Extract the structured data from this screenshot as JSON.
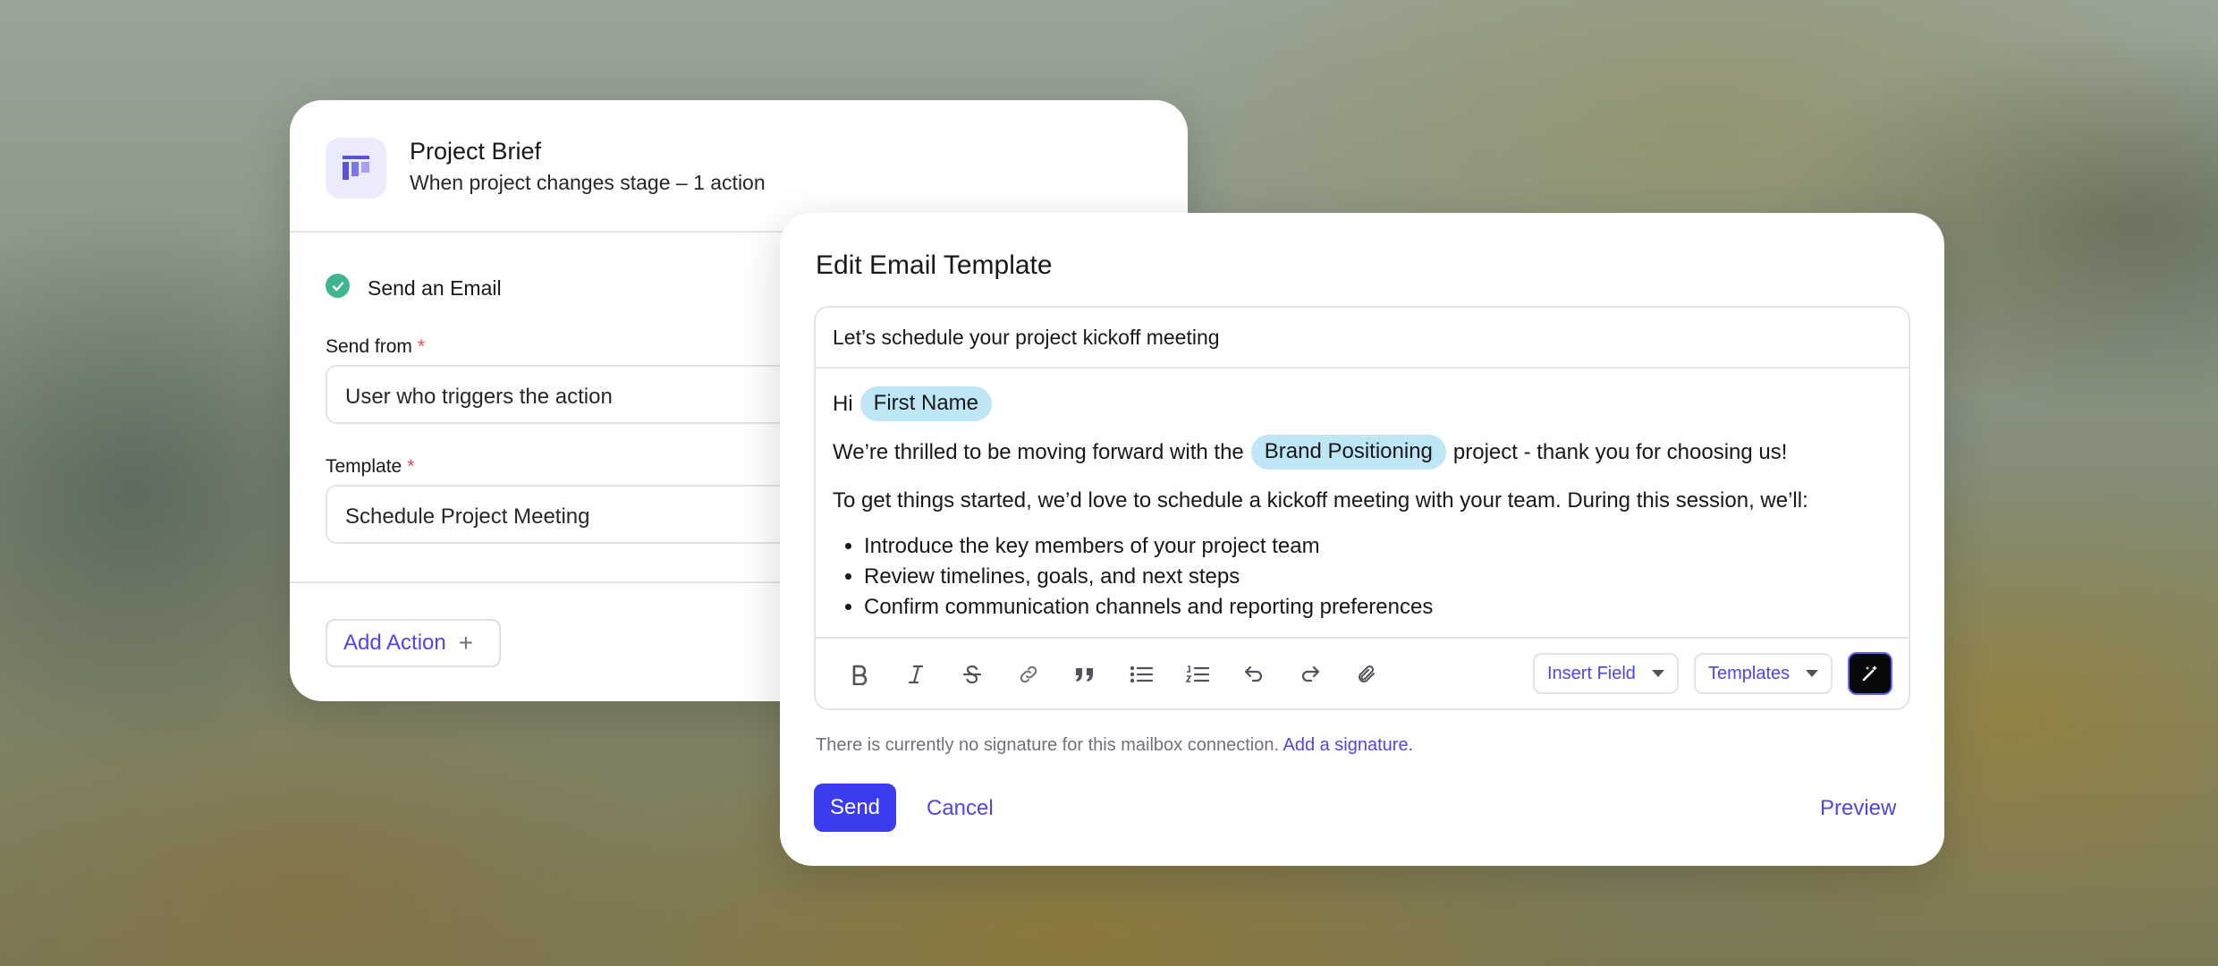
{
  "brief": {
    "title": "Project Brief",
    "subtitle": "When project changes stage – 1 action",
    "logo_icon": "board-columns-icon",
    "action_label": "Send an Email",
    "send_from_label": "Send from",
    "send_from_value": "User who triggers the action",
    "template_label": "Template",
    "template_value": "Schedule Project Meeting",
    "required_mark": "*",
    "add_action_label": "Add Action",
    "add_action_icon": "+"
  },
  "email": {
    "title": "Edit Email Template",
    "subject": "Let’s schedule your project kickoff meeting",
    "greeting": "Hi",
    "first_name_chip": "First Name",
    "line2_before": "We’re thrilled to be moving forward with the",
    "project_chip": "Brand Positioning",
    "line2_after": "project - thank you for choosing us!",
    "line3": "To get things started, we’d love to schedule a kickoff meeting with your team. During this session, we’ll:",
    "bullets": [
      "Introduce the key members of your project team",
      "Review timelines, goals, and next steps",
      "Confirm communication channels and reporting preferences"
    ],
    "toolbar_icons": [
      "bold-icon",
      "italic-icon",
      "strikethrough-icon",
      "link-icon",
      "quote-icon",
      "bullet-list-icon",
      "numbered-list-icon",
      "undo-icon",
      "redo-icon",
      "attachment-icon",
      "magic-wand-icon"
    ],
    "insert_field_label": "Insert Field",
    "templates_label": "Templates",
    "signature_note": "There is currently no signature for this mailbox connection.",
    "signature_link": "Add a signature.",
    "send_label": "Send",
    "cancel_label": "Cancel",
    "preview_label": "Preview"
  },
  "colors": {
    "accent": "#4f46e5",
    "send_button": "#3b3bf0",
    "chip": "#bfe6f5",
    "success": "#3fb691",
    "required": "#e5484d"
  }
}
